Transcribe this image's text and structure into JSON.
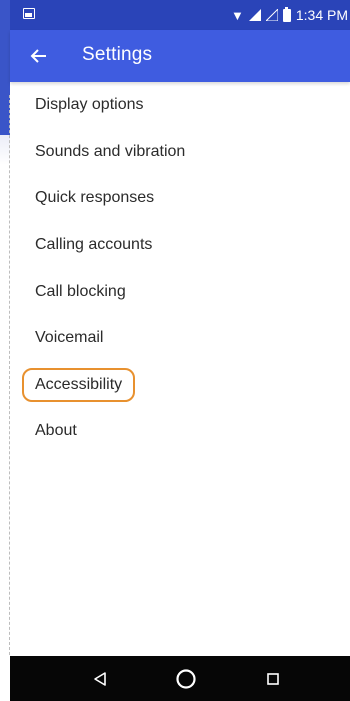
{
  "status_bar": {
    "time": "1:34 PM"
  },
  "app_bar": {
    "title": "Settings",
    "back_icon": "arrow-back-icon"
  },
  "menu": {
    "items": [
      {
        "label": "Display options"
      },
      {
        "label": "Sounds and vibration"
      },
      {
        "label": "Quick responses"
      },
      {
        "label": "Calling accounts"
      },
      {
        "label": "Call blocking"
      },
      {
        "label": "Voicemail"
      },
      {
        "label": "Accessibility",
        "highlighted": true
      },
      {
        "label": "About"
      }
    ]
  },
  "nav_bar": {
    "icons": [
      "back-triangle-icon",
      "home-circle-icon",
      "recents-square-icon"
    ]
  },
  "colors": {
    "status_bar": "#2a44b8",
    "app_bar": "#3f5ce0",
    "highlight": "#e8912f",
    "nav_bar": "#060606"
  }
}
